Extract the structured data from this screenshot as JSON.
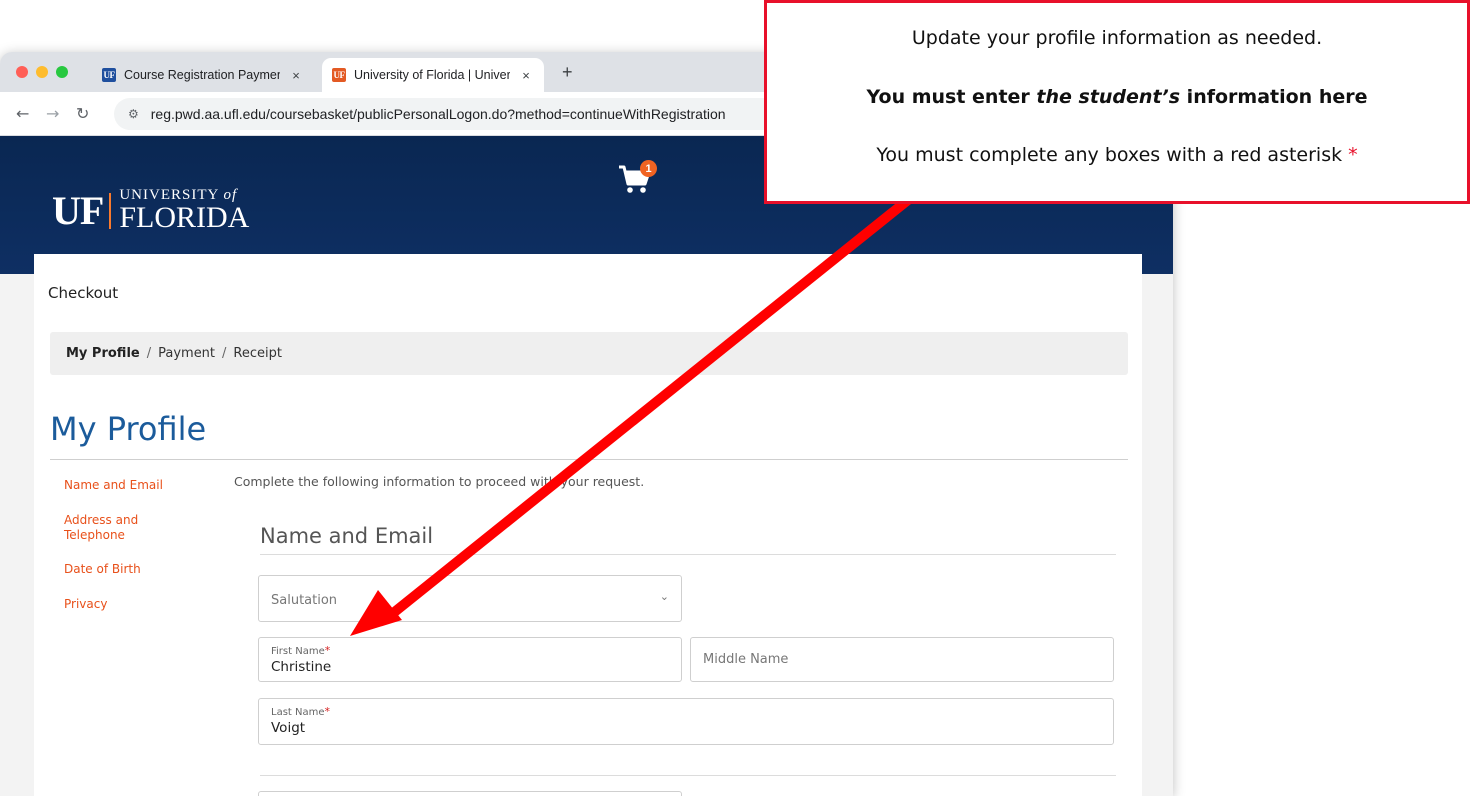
{
  "browser": {
    "tabs": [
      {
        "favicon": "UF",
        "title": "Course Registration Payment",
        "close": "×"
      },
      {
        "favicon": "UF",
        "title": "University of Florida | Univers",
        "close": "×"
      }
    ],
    "new_tab": "+",
    "url": "reg.pwd.aa.ufl.edu/coursebasket/publicPersonalLogon.do?method=continueWithRegistration"
  },
  "header": {
    "logo_uf": "UF",
    "logo_university": "UNIVERSITY",
    "logo_of": "of",
    "logo_florida": "FLORIDA",
    "cart_count": "1"
  },
  "page": {
    "checkout": "Checkout",
    "breadcrumb": {
      "current": "My Profile",
      "items": [
        "Payment",
        "Receipt"
      ],
      "separator": "/"
    },
    "title": "My Profile",
    "sidenav": [
      "Name and Email",
      "Address and Telephone",
      "Date of Birth",
      "Privacy"
    ],
    "intro": "Complete the following information to proceed with your request.",
    "section_title": "Name and Email",
    "form": {
      "salutation_placeholder": "Salutation",
      "first_name_label": "First Name",
      "first_name_value": "Christine",
      "middle_name_placeholder": "Middle Name",
      "last_name_label": "Last Name",
      "last_name_value": "Voigt",
      "required_mark": "*"
    }
  },
  "callout": {
    "line1": "Update your profile information as needed.",
    "line2_prefix": "You must enter ",
    "line2_em": "the student’s",
    "line2_suffix": " information here",
    "line3": "You must complete any boxes with a red asterisk ",
    "line3_mark": "*"
  },
  "colors": {
    "uf_blue": "#0a2752",
    "uf_orange": "#e8501a",
    "title_blue": "#1b5b9b",
    "callout_red": "#e8102a"
  }
}
